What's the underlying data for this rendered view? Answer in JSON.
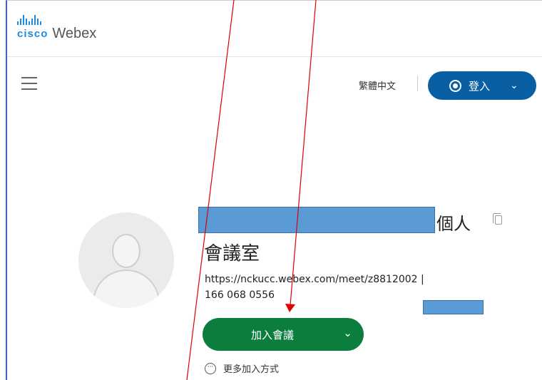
{
  "header": {
    "brand_cisco": "cisco",
    "brand_product": "Webex",
    "language": "繁體中文",
    "signin_label": "登入",
    "signin_chevron": "⌄",
    "colors": {
      "brand": "#1d8ce0",
      "signin_bg": "#0a5fa3"
    }
  },
  "room": {
    "title_suffix": "個人",
    "title_line2": "會議室",
    "url": "https://nckucc.webex.com/meet/z8812002  |",
    "number": "166 068 0556",
    "join_label": "加入會議",
    "join_chevron": "⌄",
    "more_label": "更多加入方式",
    "colors": {
      "join_bg": "#0b7d3d",
      "redaction": "#5b9bd5",
      "annotation_red": "#e00000"
    }
  }
}
